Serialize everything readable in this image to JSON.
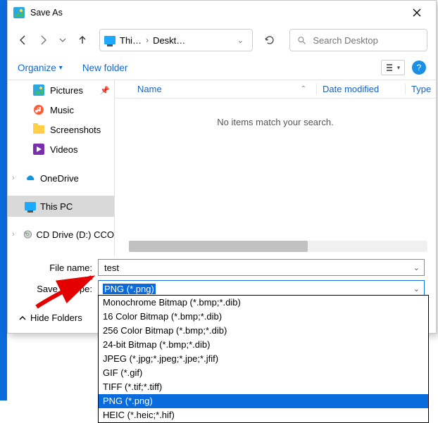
{
  "window": {
    "title": "Save As"
  },
  "nav": {
    "crumbs": [
      "Thi…",
      "Deskt…"
    ]
  },
  "search": {
    "placeholder": "Search Desktop"
  },
  "toolbar": {
    "organize": "Organize",
    "new_folder": "New folder"
  },
  "sidebar": {
    "pictures": "Pictures",
    "music": "Music",
    "screenshots": "Screenshots",
    "videos": "Videos",
    "onedrive": "OneDrive",
    "thispc": "This PC",
    "cddrive": "CD Drive (D:) CCO"
  },
  "columns": {
    "name": "Name",
    "date": "Date modified",
    "type": "Type"
  },
  "empty_text": "No items match your search.",
  "fields": {
    "filename_label": "File name:",
    "filename_value": "test",
    "type_label": "Save as type:",
    "type_value": "PNG (*.png)"
  },
  "footer": {
    "hide_folders": "Hide Folders"
  },
  "dropdown": {
    "items": [
      "Monochrome Bitmap (*.bmp;*.dib)",
      "16 Color Bitmap (*.bmp;*.dib)",
      "256 Color Bitmap (*.bmp;*.dib)",
      "24-bit Bitmap (*.bmp;*.dib)",
      "JPEG (*.jpg;*.jpeg;*.jpe;*.jfif)",
      "GIF (*.gif)",
      "TIFF (*.tif;*.tiff)",
      "PNG (*.png)",
      "HEIC (*.heic;*.hif)"
    ],
    "selected_index": 7
  }
}
